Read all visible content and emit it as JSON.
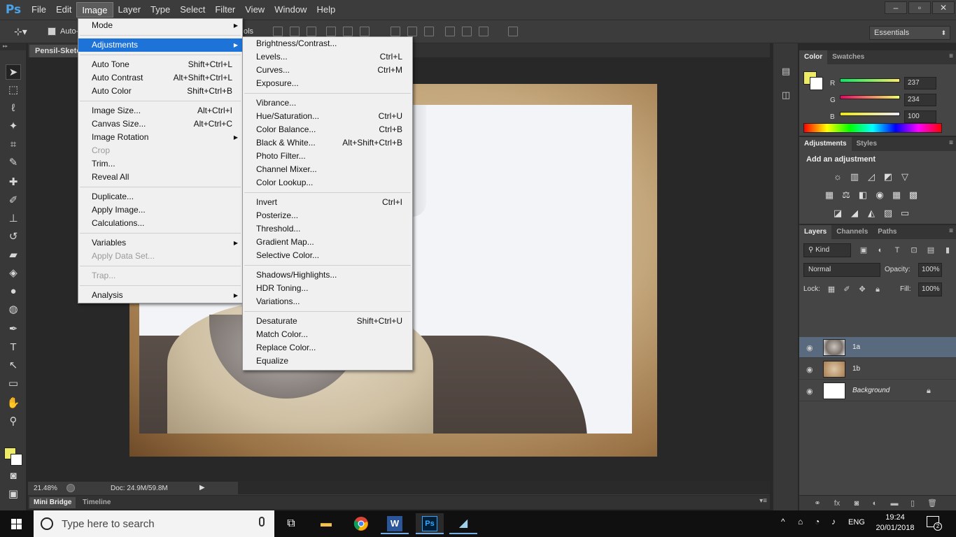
{
  "app": {
    "logo": "Ps",
    "menus": [
      "File",
      "Edit",
      "Image",
      "Layer",
      "Type",
      "Select",
      "Filter",
      "View",
      "Window",
      "Help"
    ],
    "active_menu": "Image",
    "window_controls": [
      "–",
      "▫",
      "✕"
    ]
  },
  "options_bar": {
    "auto_label": "Auto-",
    "controls_suffix": "ols",
    "workspace": "Essentials"
  },
  "document": {
    "tab_label": "Pensil-Sketc",
    "zoom": "21.48%",
    "doc_size": "Doc: 24.9M/59.8M"
  },
  "bottom_tabs": [
    "Mini Bridge",
    "Timeline"
  ],
  "colors": {
    "foreground": "#eeeb64",
    "background": "#ffffff",
    "menu_highlight": "#1e73d8",
    "layer_selected": "#5a6a7e"
  },
  "image_menu": {
    "items": [
      {
        "label": "Mode",
        "submenu": true
      },
      {
        "sep": true
      },
      {
        "label": "Adjustments",
        "submenu": true,
        "highlight": true
      },
      {
        "sep": true
      },
      {
        "label": "Auto Tone",
        "shortcut": "Shift+Ctrl+L"
      },
      {
        "label": "Auto Contrast",
        "shortcut": "Alt+Shift+Ctrl+L"
      },
      {
        "label": "Auto Color",
        "shortcut": "Shift+Ctrl+B"
      },
      {
        "sep": true
      },
      {
        "label": "Image Size...",
        "shortcut": "Alt+Ctrl+I"
      },
      {
        "label": "Canvas Size...",
        "shortcut": "Alt+Ctrl+C"
      },
      {
        "label": "Image Rotation",
        "submenu": true
      },
      {
        "label": "Crop",
        "disabled": true
      },
      {
        "label": "Trim..."
      },
      {
        "label": "Reveal All"
      },
      {
        "sep": true
      },
      {
        "label": "Duplicate..."
      },
      {
        "label": "Apply Image..."
      },
      {
        "label": "Calculations..."
      },
      {
        "sep": true
      },
      {
        "label": "Variables",
        "submenu": true
      },
      {
        "label": "Apply Data Set...",
        "disabled": true
      },
      {
        "sep": true
      },
      {
        "label": "Trap...",
        "disabled": true
      },
      {
        "sep": true
      },
      {
        "label": "Analysis",
        "submenu": true
      }
    ]
  },
  "adjustments_menu": {
    "items": [
      {
        "label": "Brightness/Contrast..."
      },
      {
        "label": "Levels...",
        "shortcut": "Ctrl+L"
      },
      {
        "label": "Curves...",
        "shortcut": "Ctrl+M"
      },
      {
        "label": "Exposure..."
      },
      {
        "sep": true
      },
      {
        "label": "Vibrance..."
      },
      {
        "label": "Hue/Saturation...",
        "shortcut": "Ctrl+U"
      },
      {
        "label": "Color Balance...",
        "shortcut": "Ctrl+B"
      },
      {
        "label": "Black & White...",
        "shortcut": "Alt+Shift+Ctrl+B"
      },
      {
        "label": "Photo Filter..."
      },
      {
        "label": "Channel Mixer..."
      },
      {
        "label": "Color Lookup..."
      },
      {
        "sep": true
      },
      {
        "label": "Invert",
        "shortcut": "Ctrl+I"
      },
      {
        "label": "Posterize..."
      },
      {
        "label": "Threshold..."
      },
      {
        "label": "Gradient Map..."
      },
      {
        "label": "Selective Color..."
      },
      {
        "sep": true
      },
      {
        "label": "Shadows/Highlights..."
      },
      {
        "label": "HDR Toning..."
      },
      {
        "label": "Variations..."
      },
      {
        "sep": true
      },
      {
        "label": "Desaturate",
        "shortcut": "Shift+Ctrl+U"
      },
      {
        "label": "Match Color..."
      },
      {
        "label": "Replace Color..."
      },
      {
        "label": "Equalize"
      }
    ]
  },
  "color_panel": {
    "tabs": [
      "Color",
      "Swatches"
    ],
    "channels": [
      {
        "label": "R",
        "value": "237"
      },
      {
        "label": "G",
        "value": "234"
      },
      {
        "label": "B",
        "value": "100"
      }
    ]
  },
  "adjustments_panel": {
    "tabs": [
      "Adjustments",
      "Styles"
    ],
    "title": "Add an adjustment",
    "icons_row1": [
      "☼",
      "▥",
      "◿",
      "◩",
      "▽"
    ],
    "icons_row2": [
      "▦",
      "⚖",
      "◧",
      "◉",
      "▦"
    ],
    "icons_row3": [
      "◪",
      "◢",
      "◭",
      "▨",
      "▭"
    ]
  },
  "layers_panel": {
    "tabs": [
      "Layers",
      "Channels",
      "Paths"
    ],
    "kind_label": "Kind",
    "blend_mode": "Normal",
    "opacity_label": "Opacity:",
    "opacity": "100%",
    "lock_label": "Lock:",
    "fill_label": "Fill:",
    "fill": "100%",
    "layers": [
      {
        "name": "1a",
        "selected": true
      },
      {
        "name": "1b",
        "selected": false
      },
      {
        "name": "Background",
        "selected": false
      }
    ]
  },
  "taskbar": {
    "search_placeholder": "Type here to search",
    "language": "ENG",
    "time": "19:24",
    "date": "20/01/2018",
    "notification_count": "2"
  }
}
